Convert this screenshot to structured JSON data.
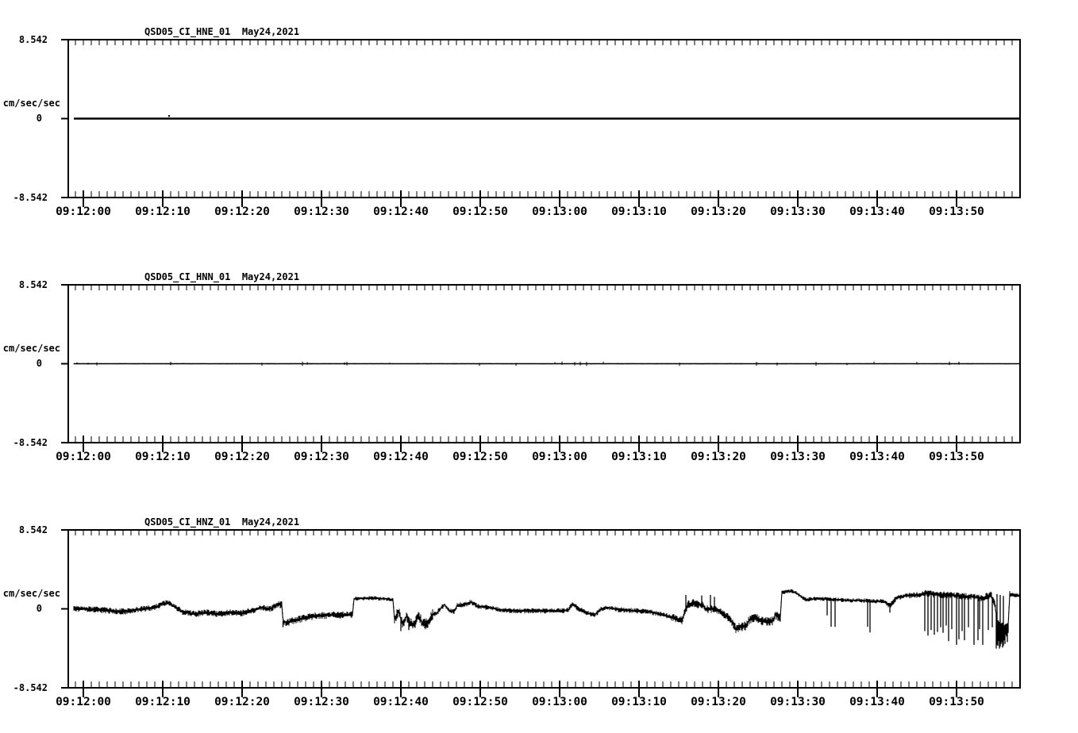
{
  "page": {
    "background": "#ffffff",
    "ink_color": "#000000"
  },
  "chart_data": [
    {
      "type": "line",
      "title": "QSD05_CI_HNE_01  May24,2021",
      "ylabel": "cm/sec/sec",
      "ylim": [
        -8.542,
        8.542
      ],
      "y_tick_labels": [
        "8.542",
        "0",
        "-8.542"
      ],
      "y_tick_values": [
        8.542,
        0,
        -8.542
      ],
      "x_tick_labels": [
        "09:12:00",
        "09:12:10",
        "09:12:20",
        "09:12:30",
        "09:12:40",
        "09:12:50",
        "09:13:00",
        "09:13:10",
        "09:13:20",
        "09:13:30",
        "09:13:40",
        "09:13:50"
      ],
      "x_tick_seconds": [
        0,
        10,
        20,
        30,
        40,
        50,
        60,
        70,
        80,
        90,
        100,
        110
      ],
      "x_seconds_range": [
        -1.2,
        118
      ],
      "grid": false,
      "legend": null,
      "baseline": [
        [
          -1.2,
          0
        ],
        [
          118,
          0
        ]
      ],
      "noise_segments": [],
      "spikes": [],
      "dots": [
        [
          10.8,
          0.28
        ]
      ]
    },
    {
      "type": "line",
      "title": "QSD05_CI_HNN_01  May24,2021",
      "ylabel": "cm/sec/sec",
      "ylim": [
        -8.542,
        8.542
      ],
      "y_tick_labels": [
        "8.542",
        "0",
        "-8.542"
      ],
      "y_tick_values": [
        8.542,
        0,
        -8.542
      ],
      "x_tick_labels": [
        "09:12:00",
        "09:12:10",
        "09:12:20",
        "09:12:30",
        "09:12:40",
        "09:12:50",
        "09:13:00",
        "09:13:10",
        "09:13:20",
        "09:13:30",
        "09:13:40",
        "09:13:50"
      ],
      "x_tick_seconds": [
        0,
        10,
        20,
        30,
        40,
        50,
        60,
        70,
        80,
        90,
        100,
        110
      ],
      "x_seconds_range": [
        -1.2,
        118
      ],
      "grid": false,
      "legend": null,
      "baseline": [
        [
          -1.2,
          0
        ],
        [
          118,
          0
        ]
      ],
      "noise_segments": [
        [
          -1.2,
          118,
          0.055
        ]
      ],
      "spikes": [],
      "dots": []
    },
    {
      "type": "line",
      "title": "QSD05_CI_HNZ_01  May24,2021",
      "ylabel": "cm/sec/sec",
      "ylim": [
        -8.542,
        8.542
      ],
      "y_tick_labels": [
        "8.542",
        "0",
        "-8.542"
      ],
      "y_tick_values": [
        8.542,
        0,
        -8.542
      ],
      "x_tick_labels": [
        "09:12:00",
        "09:12:10",
        "09:12:20",
        "09:12:30",
        "09:12:40",
        "09:12:50",
        "09:13:00",
        "09:13:10",
        "09:13:20",
        "09:13:30",
        "09:13:40",
        "09:13:50"
      ],
      "x_tick_seconds": [
        0,
        10,
        20,
        30,
        40,
        50,
        60,
        70,
        80,
        90,
        100,
        110
      ],
      "x_seconds_range": [
        -1.2,
        118
      ],
      "grid": false,
      "legend": null,
      "baseline": [
        [
          -1.2,
          0.04
        ],
        [
          1.5,
          -0.04
        ],
        [
          3.5,
          -0.22
        ],
        [
          5.5,
          -0.3
        ],
        [
          7,
          -0.04
        ],
        [
          9,
          0.13
        ],
        [
          10,
          0.56
        ],
        [
          10.7,
          0.65
        ],
        [
          11.5,
          0.22
        ],
        [
          12.5,
          -0.3
        ],
        [
          14,
          -0.56
        ],
        [
          15.5,
          -0.39
        ],
        [
          17,
          -0.56
        ],
        [
          18.5,
          -0.39
        ],
        [
          20,
          -0.47
        ],
        [
          21.5,
          -0.13
        ],
        [
          22.5,
          0.13
        ],
        [
          23.5,
          -0.04
        ],
        [
          24.3,
          0.39
        ],
        [
          24.7,
          0.47
        ],
        [
          25.0,
          0.4
        ],
        [
          25.15,
          -1.34
        ],
        [
          25.7,
          -1.51
        ],
        [
          26.5,
          -1.25
        ],
        [
          27.5,
          -1.08
        ],
        [
          28.7,
          -0.82
        ],
        [
          30,
          -0.73
        ],
        [
          31.5,
          -0.65
        ],
        [
          33,
          -0.65
        ],
        [
          33.9,
          -0.65
        ],
        [
          34.1,
          1.08
        ],
        [
          35.3,
          1.16
        ],
        [
          36.7,
          1.16
        ],
        [
          38.1,
          1.08
        ],
        [
          38.8,
          0.99
        ],
        [
          39.0,
          0.95
        ],
        [
          39.2,
          -1.16
        ],
        [
          39.7,
          -0.3
        ],
        [
          40.2,
          -1.6
        ],
        [
          40.7,
          -0.82
        ],
        [
          41.2,
          -1.51
        ],
        [
          41.7,
          -1.77
        ],
        [
          42.2,
          -0.65
        ],
        [
          42.7,
          -1.6
        ],
        [
          43.3,
          -1.6
        ],
        [
          44,
          -0.65
        ],
        [
          44.6,
          -0.39
        ],
        [
          45.1,
          0.13
        ],
        [
          45.5,
          0.47
        ],
        [
          46.1,
          -0.22
        ],
        [
          46.7,
          -0.3
        ],
        [
          47.1,
          0.39
        ],
        [
          48.1,
          0.47
        ],
        [
          48.8,
          0.73
        ],
        [
          49.6,
          0.3
        ],
        [
          51.1,
          0.13
        ],
        [
          52.6,
          -0.13
        ],
        [
          54.1,
          -0.22
        ],
        [
          57.3,
          -0.22
        ],
        [
          60.1,
          -0.22
        ],
        [
          61.1,
          -0.13
        ],
        [
          61.6,
          0.56
        ],
        [
          62.4,
          -0.04
        ],
        [
          63.6,
          -0.47
        ],
        [
          64.4,
          -0.65
        ],
        [
          65.2,
          -0.04
        ],
        [
          66.1,
          0.13
        ],
        [
          67.1,
          -0.04
        ],
        [
          68.1,
          -0.13
        ],
        [
          69.6,
          -0.22
        ],
        [
          71.1,
          -0.3
        ],
        [
          72.1,
          -0.47
        ],
        [
          73.1,
          -0.65
        ],
        [
          74.1,
          -0.91
        ],
        [
          74.8,
          -1.08
        ],
        [
          75.4,
          -1.25
        ],
        [
          75.8,
          -0.22
        ],
        [
          76.2,
          0.47
        ],
        [
          76.8,
          0.65
        ],
        [
          77.4,
          0.47
        ],
        [
          78,
          0.47
        ],
        [
          78.4,
          -0.04
        ],
        [
          78.9,
          -0.04
        ],
        [
          79.4,
          0.04
        ],
        [
          80.1,
          -0.22
        ],
        [
          80.8,
          -0.65
        ],
        [
          81.6,
          -1.25
        ],
        [
          82.2,
          -2.2
        ],
        [
          82.8,
          -1.94
        ],
        [
          83.4,
          -1.86
        ],
        [
          84,
          -1.08
        ],
        [
          84.6,
          -0.91
        ],
        [
          85.4,
          -1.25
        ],
        [
          86.1,
          -1.42
        ],
        [
          86.8,
          -1.34
        ],
        [
          87.2,
          -0.65
        ],
        [
          87.6,
          -0.91
        ],
        [
          87.8,
          -0.9
        ],
        [
          88.0,
          1.77
        ],
        [
          89.1,
          1.94
        ],
        [
          89.9,
          1.68
        ],
        [
          90.4,
          1.34
        ],
        [
          91.1,
          0.99
        ],
        [
          92.1,
          1.08
        ],
        [
          93.6,
          1.08
        ],
        [
          95.1,
          0.99
        ],
        [
          96.6,
          0.91
        ],
        [
          98.1,
          0.91
        ],
        [
          99.6,
          0.82
        ],
        [
          100.8,
          0.82
        ],
        [
          101.6,
          0.3
        ],
        [
          102.4,
          1.16
        ],
        [
          103.6,
          1.42
        ],
        [
          105.1,
          1.51
        ],
        [
          106.1,
          1.68
        ],
        [
          107.1,
          1.6
        ],
        [
          108.1,
          1.51
        ],
        [
          109.1,
          1.51
        ],
        [
          110.1,
          1.42
        ],
        [
          111.1,
          1.34
        ],
        [
          111.9,
          1.34
        ],
        [
          112.6,
          1.25
        ],
        [
          113.3,
          1.08
        ],
        [
          113.8,
          1.34
        ],
        [
          114.3,
          1.51
        ],
        [
          114.8,
          0.65
        ],
        [
          115.1,
          -1.25
        ],
        [
          115.3,
          -1.51
        ],
        [
          115.8,
          -1.94
        ],
        [
          116.2,
          -1.94
        ],
        [
          116.5,
          -1.77
        ],
        [
          116.7,
          1.51
        ],
        [
          117.3,
          1.51
        ],
        [
          118,
          1.42
        ]
      ],
      "noise_segments": [
        [
          -1.2,
          24.5,
          0.3
        ],
        [
          24.5,
          34,
          0.35
        ],
        [
          34,
          39,
          0.2
        ],
        [
          39,
          44,
          0.55
        ],
        [
          44,
          61,
          0.25
        ],
        [
          61,
          74,
          0.25
        ],
        [
          74,
          82,
          0.38
        ],
        [
          82,
          88,
          0.45
        ],
        [
          88,
          101,
          0.2
        ],
        [
          101,
          105,
          0.28
        ],
        [
          105,
          113.5,
          0.33
        ],
        [
          113.5,
          116.7,
          0.4
        ],
        [
          116.7,
          118,
          0.22
        ]
      ],
      "spikes": [
        [
          25.15,
          -2.0
        ],
        [
          40.0,
          -2.4
        ],
        [
          41.0,
          -2.3
        ],
        [
          75.9,
          1.5
        ],
        [
          77.9,
          1.45
        ],
        [
          79.0,
          1.5
        ],
        [
          79.5,
          1.3
        ],
        [
          93.7,
          -0.7
        ],
        [
          94.2,
          -1.94
        ],
        [
          94.7,
          -1.94
        ],
        [
          98.8,
          -1.94
        ],
        [
          99.1,
          -2.55
        ],
        [
          101.6,
          -0.4
        ],
        [
          106.0,
          -2.4
        ],
        [
          106.4,
          -2.9
        ],
        [
          106.8,
          -2.3
        ],
        [
          107.2,
          -2.8
        ],
        [
          107.6,
          -2.5
        ],
        [
          108.0,
          -2.0
        ],
        [
          108.3,
          -2.6
        ],
        [
          108.7,
          -1.8
        ],
        [
          109.0,
          -3.5
        ],
        [
          109.4,
          -2.2
        ],
        [
          110.0,
          -3.9
        ],
        [
          110.3,
          -3.3
        ],
        [
          110.7,
          -2.4
        ],
        [
          111.0,
          -3.4
        ],
        [
          111.5,
          -2.0
        ],
        [
          112.2,
          -3.9
        ],
        [
          112.7,
          -3.4
        ],
        [
          112.9,
          -2.2
        ],
        [
          113.3,
          -3.9
        ],
        [
          114.0,
          -2.3
        ],
        [
          114.5,
          -2.0
        ],
        [
          115.0,
          -4.3
        ],
        [
          115.1,
          -3.9
        ],
        [
          115.2,
          -4.0
        ],
        [
          115.3,
          -3.5
        ],
        [
          115.4,
          -4.3
        ],
        [
          115.5,
          -4.1
        ],
        [
          115.6,
          -3.8
        ],
        [
          115.7,
          -3.6
        ],
        [
          115.8,
          -4.2
        ],
        [
          115.9,
          -4.0
        ],
        [
          116.0,
          -3.4
        ],
        [
          116.1,
          -3.8
        ],
        [
          116.2,
          -2.8
        ],
        [
          116.3,
          -3.0
        ],
        [
          116.4,
          -3.6
        ],
        [
          116.5,
          -2.6
        ],
        [
          115.1,
          1.6
        ],
        [
          115.5,
          1.5
        ],
        [
          115.9,
          1.4
        ]
      ],
      "dots": []
    }
  ],
  "render": {
    "noise_seed": 42
  }
}
